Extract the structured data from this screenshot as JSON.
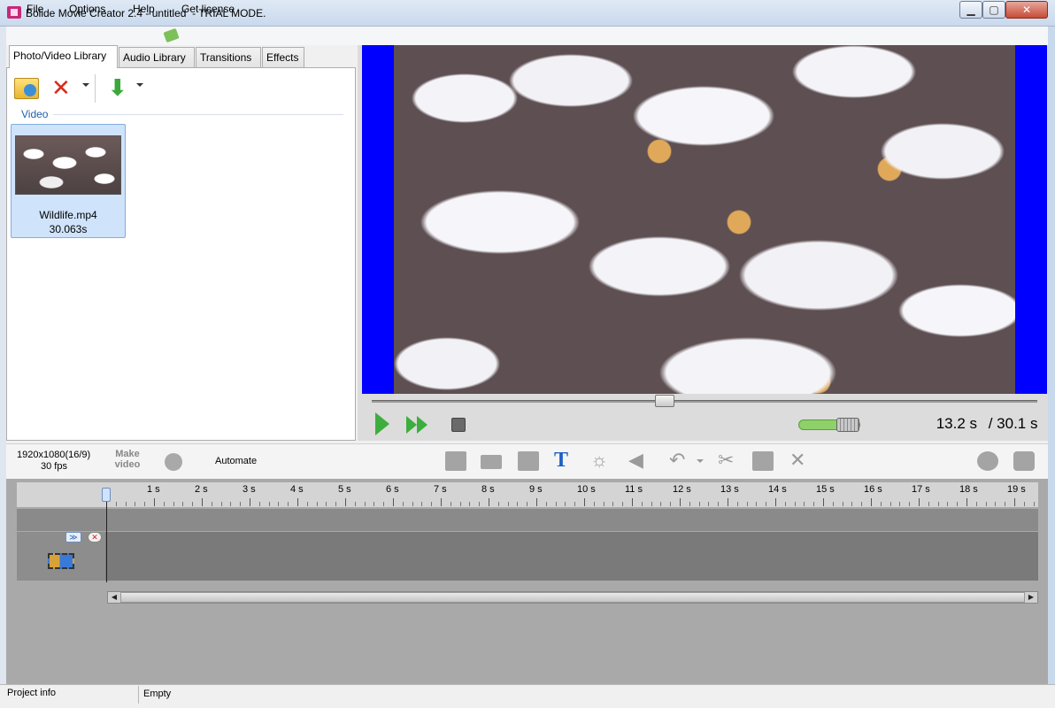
{
  "window": {
    "title": "Bolide Movie Creator 2.4 - untitled  - TRIAL MODE.",
    "min": "▁",
    "max": "▢",
    "close": "✕"
  },
  "menu": {
    "file": "File",
    "options": "Options",
    "help": "Help",
    "license": "Get license"
  },
  "tabs": [
    "Photo/Video Library",
    "Audio Library",
    "Transitions",
    "Effects"
  ],
  "library": {
    "section": "Video",
    "items": [
      {
        "name": "Wildlife.mp4",
        "duration": "30.063s"
      }
    ],
    "toolbar_icons": [
      "open-folder-icon",
      "delete-icon",
      "import-icon"
    ]
  },
  "player": {
    "current_time": "13.2 s",
    "total_time": " / 30.1 s",
    "position_fraction": 0.44,
    "volume_fraction": 0.9
  },
  "project": {
    "resolution": "1920x1080(16/9)",
    "fps": "30 fps",
    "make_video": "Make video",
    "automate": "Automate"
  },
  "timeline": {
    "ticks": [
      "1 s",
      "2 s",
      "3 s",
      "4 s",
      "5 s",
      "6 s",
      "7 s",
      "8 s",
      "9 s",
      "10 s",
      "11 s",
      "12 s",
      "13 s",
      "14 s",
      "15 s",
      "16 s",
      "17 s",
      "18 s",
      "19 s"
    ]
  },
  "status": {
    "left": "Project info",
    "right": "Empty"
  },
  "colors": {
    "accent": "#1e5fc4",
    "play": "#3dae3d",
    "letterbox": "#0000ff"
  }
}
